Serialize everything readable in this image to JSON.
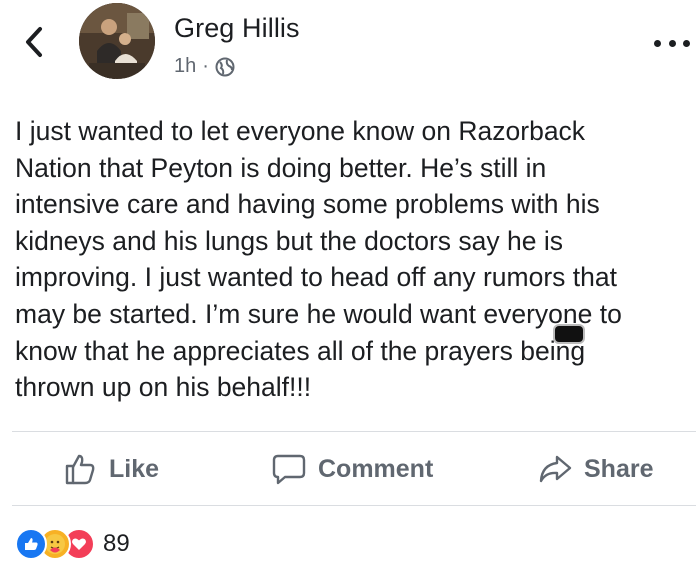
{
  "post": {
    "author": "Greg Hillis",
    "time": "1h",
    "separator": "·",
    "privacy_icon": "globe-icon",
    "body": "I just wanted to let everyone know on Razorback\nNation that Peyton is doing better. He’s still in\nintensive care and having some problems with his\nkidneys and his lungs but the doctors say he is\nimproving. I just wanted to head off any rumors that\nmay be started. I’m sure he would want everyone to\nknow that he appreciates all of the prayers being\nthrown up on his behalf!!!"
  },
  "actions": {
    "like_label": "Like",
    "comment_label": "Comment",
    "share_label": "Share"
  },
  "reactions": {
    "types": [
      "like",
      "care",
      "love"
    ],
    "count": "89"
  },
  "colors": {
    "text": "#1c1e21",
    "muted": "#606770",
    "like_blue": "#1877f2",
    "care_yellow": "#f7b125",
    "love_red": "#f33e58",
    "divider": "#dadde1"
  }
}
